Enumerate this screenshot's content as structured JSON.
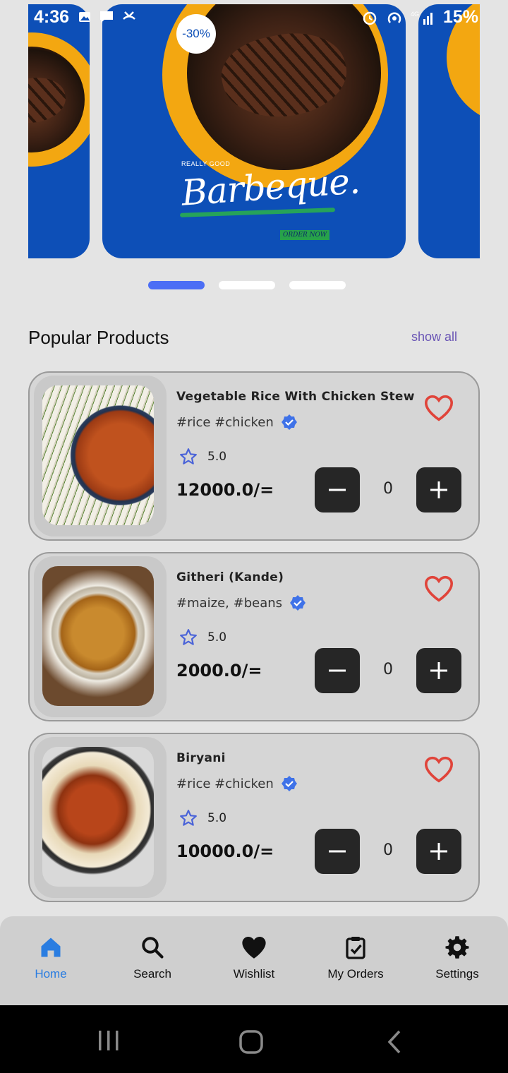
{
  "status_bar": {
    "time": "4:36",
    "battery": "15%"
  },
  "carousel": {
    "discount": "-30%",
    "tagline": "REALLY GOOD",
    "title": "Barbeque.",
    "cta": "ORDER NOW",
    "active_index": 0,
    "slide_count": 3
  },
  "popular": {
    "title": "Popular Products",
    "show_all": "show all"
  },
  "products": [
    {
      "name": "Vegetable Rice With Chicken Stew",
      "tags": "#rice #chicken",
      "rating": "5.0",
      "price": "12000.0/=",
      "qty": "0"
    },
    {
      "name": "Githeri (Kande)",
      "tags": "#maize, #beans",
      "rating": "5.0",
      "price": "2000.0/=",
      "qty": "0"
    },
    {
      "name": "Biryani",
      "tags": "#rice #chicken",
      "rating": "5.0",
      "price": "10000.0/=",
      "qty": "0"
    }
  ],
  "bottom_nav": [
    {
      "label": "Home",
      "icon": "home-icon",
      "active": true
    },
    {
      "label": "Search",
      "icon": "search-icon",
      "active": false
    },
    {
      "label": "Wishlist",
      "icon": "heart-icon",
      "active": false
    },
    {
      "label": "My Orders",
      "icon": "clipboard-check-icon",
      "active": false
    },
    {
      "label": "Settings",
      "icon": "gear-icon",
      "active": false
    }
  ],
  "colors": {
    "accent": "#2a7de1",
    "promo_blue": "#0d4fb7",
    "promo_orange": "#f3a711",
    "heart_red": "#e0443a",
    "verified_blue": "#3f72e8",
    "dot_active": "#4c6ef5"
  }
}
